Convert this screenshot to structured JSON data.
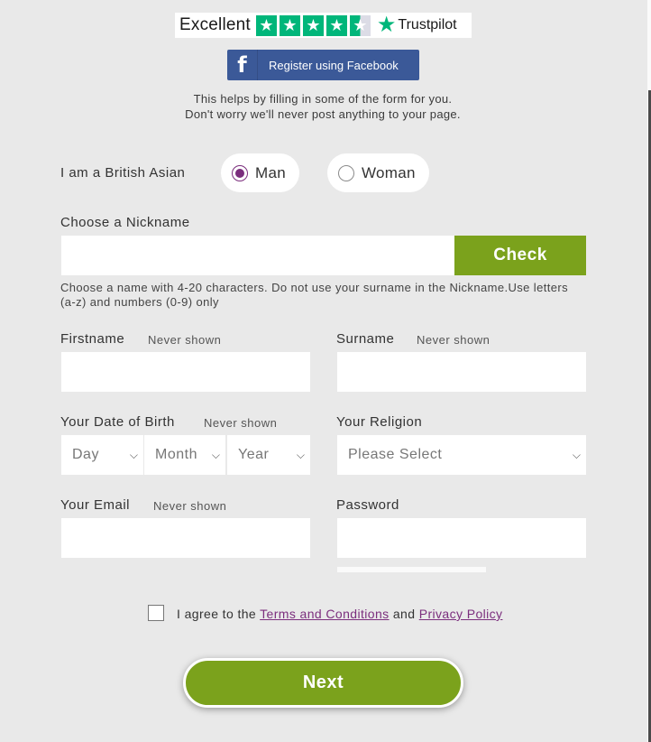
{
  "trustpilot": {
    "rating_word": "Excellent",
    "brand": "Trustpilot",
    "star_glyph": "★"
  },
  "facebook": {
    "icon_letter": "f",
    "button_label": "Register using Facebook",
    "note_line1": "This helps by filling in some of the form for you.",
    "note_line2": "Don't worry we'll never post anything to your page."
  },
  "gender": {
    "label": "I am a British Asian",
    "options": [
      {
        "label": "Man",
        "selected": true
      },
      {
        "label": "Woman",
        "selected": false
      }
    ]
  },
  "nickname": {
    "label": "Choose a Nickname",
    "value": "",
    "check_label": "Check",
    "help": "Choose a name with 4-20 characters. Do not use your surname in the Nickname.Use letters (a-z) and numbers (0-9) only"
  },
  "firstname": {
    "label": "Firstname",
    "hint": "Never shown",
    "value": ""
  },
  "surname": {
    "label": "Surname",
    "hint": "Never shown",
    "value": ""
  },
  "dob": {
    "label": "Your Date of Birth",
    "hint": "Never shown",
    "day": "Day",
    "month": "Month",
    "year": "Year"
  },
  "religion": {
    "label": "Your Religion",
    "selected": "Please Select"
  },
  "email": {
    "label": "Your Email",
    "hint": "Never shown",
    "value": ""
  },
  "password": {
    "label": "Password",
    "value": ""
  },
  "agree": {
    "prefix": "I agree to the",
    "terms": "Terms and Conditions",
    "middle": "and",
    "privacy": "Privacy Policy",
    "checked": false
  },
  "next_label": "Next",
  "colors": {
    "accent_green": "#7ba21c",
    "brand_purple": "#7b2e7d",
    "facebook_blue": "#3b5998",
    "trustpilot_green": "#00b67a"
  },
  "icons": {
    "select_arrow": "chevron-down-icon",
    "radio": "radio-icon"
  }
}
